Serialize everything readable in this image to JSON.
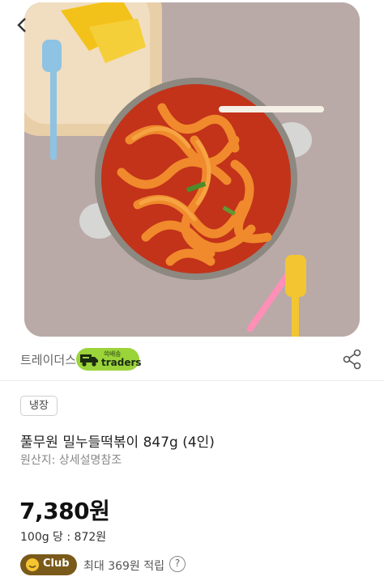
{
  "hero": {
    "image": "tteokbokki-pot-photo"
  },
  "seller": {
    "name": "트레이더스",
    "badge_top": "쓱배송",
    "badge_main": "traders",
    "share_icon": "share-icon"
  },
  "product": {
    "storage_tag": "냉장",
    "title": "풀무원 밀누들떡볶이 847g (4인)",
    "origin": "원산지: 상세설명참조",
    "price": "7,380원",
    "unit_price": "100g 당 : 872원"
  },
  "club": {
    "badge_label": "Club",
    "reward": "최대 369원 적립",
    "help": "?"
  },
  "colors": {
    "traders_green": "#9bd33a",
    "club_brown": "#7a5a1a"
  }
}
